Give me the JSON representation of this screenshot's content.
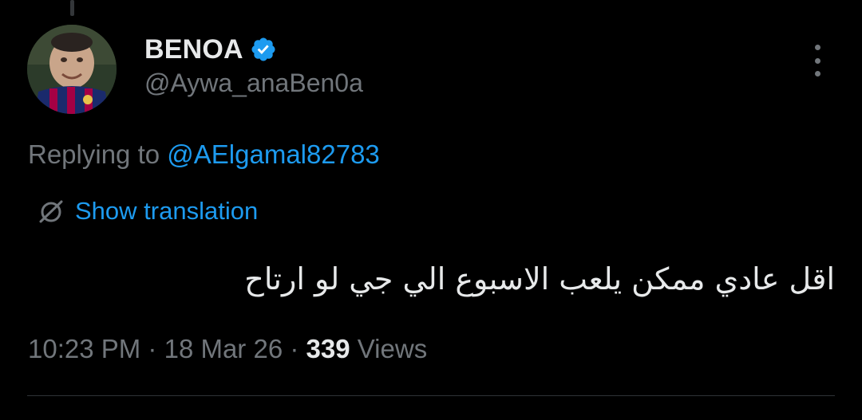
{
  "author": {
    "display_name": "BENOA",
    "handle": "@Aywa_anaBen0a",
    "verified": true,
    "verified_color": "#1d9bf0",
    "avatar_icon": "avatar-photo-icon"
  },
  "reply": {
    "prefix": "Replying to",
    "mention": "@AElgamal82783"
  },
  "translate": {
    "label": "Show translation",
    "icon": "translate-globe-icon"
  },
  "tweet": {
    "text": "اقل عادي ممكن يلعب الاسبوع الي جي لو ارتاح"
  },
  "meta": {
    "time": "10:23 PM",
    "separator": "·",
    "date": "18 Mar 26",
    "views_count": "339",
    "views_label": "Views"
  },
  "colors": {
    "background": "#000000",
    "primary_text": "#e7e9ea",
    "secondary_text": "#71767b",
    "accent": "#1d9bf0",
    "divider": "#2f3336"
  },
  "menu": {
    "icon": "more-options-icon"
  }
}
